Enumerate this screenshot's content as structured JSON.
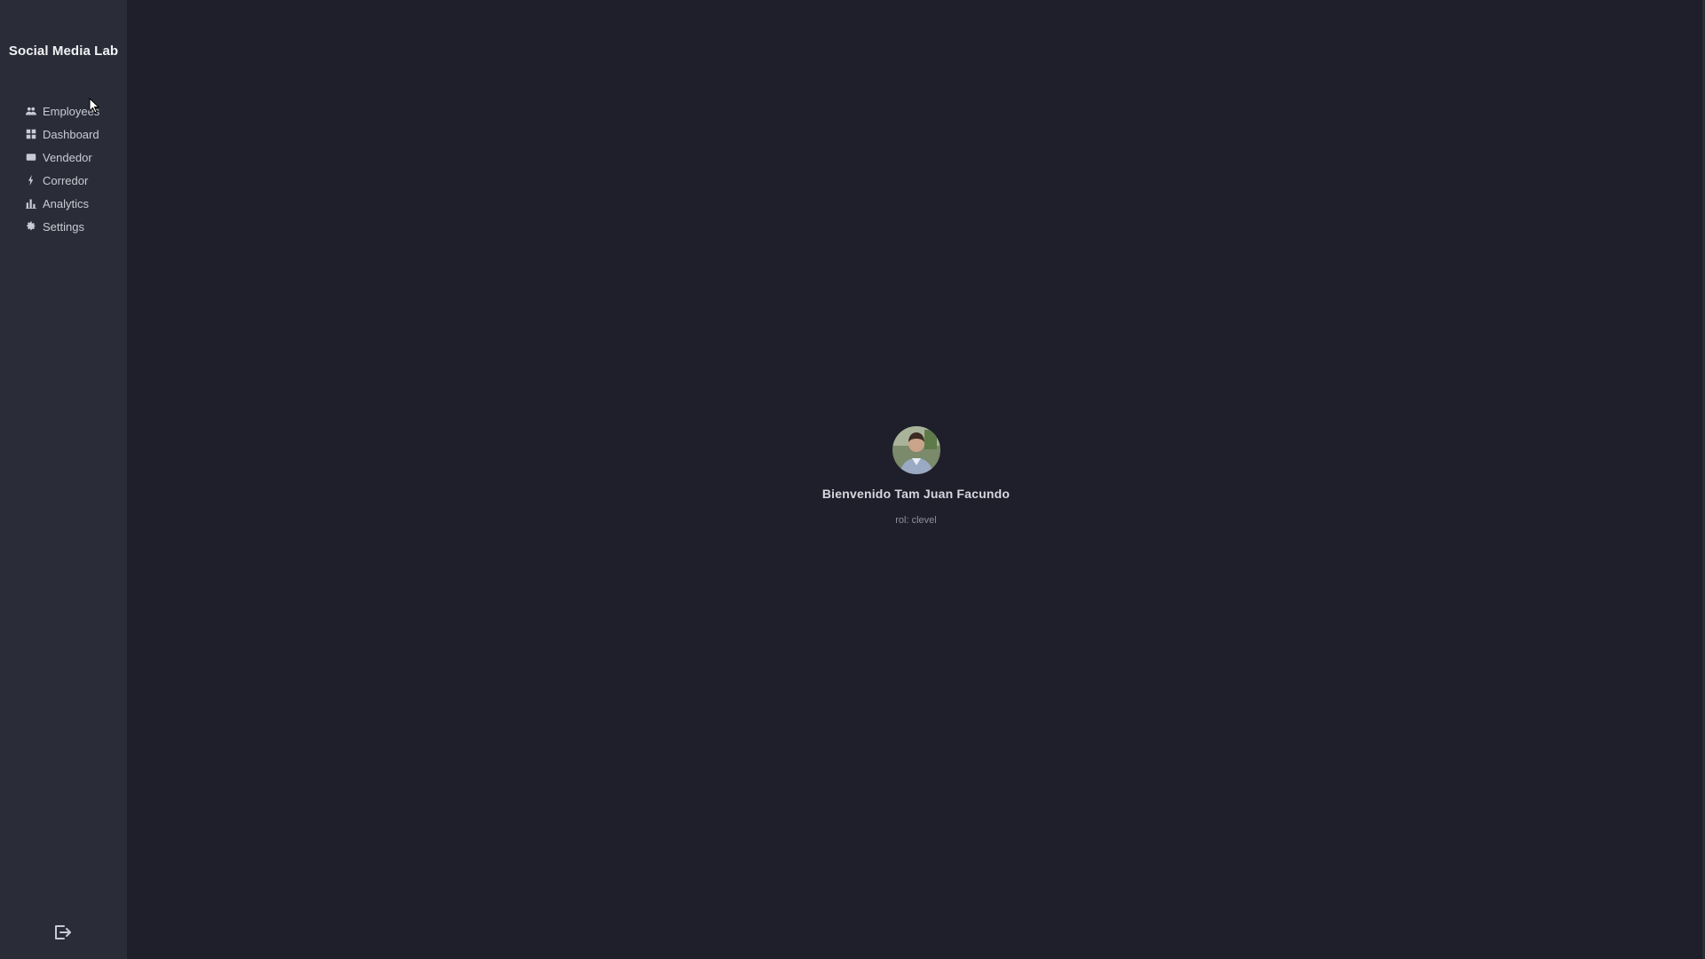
{
  "app": {
    "title": "Social Media Lab"
  },
  "sidebar": {
    "items": [
      {
        "label": "Employees",
        "icon": "users-icon"
      },
      {
        "label": "Dashboard",
        "icon": "grid-icon"
      },
      {
        "label": "Vendedor",
        "icon": "card-icon"
      },
      {
        "label": "Corredor",
        "icon": "bolt-icon"
      },
      {
        "label": "Analytics",
        "icon": "bar-chart-icon"
      },
      {
        "label": "Settings",
        "icon": "gear-icon"
      }
    ],
    "logout_icon": "logout-icon"
  },
  "main": {
    "welcome_title": "Bienvenido Tam Juan Facundo",
    "role_text": "rol: clevel"
  },
  "colors": {
    "sidebar_bg": "#2a2d38",
    "main_bg": "#1f1f2b",
    "text": "#c9cbd4"
  }
}
